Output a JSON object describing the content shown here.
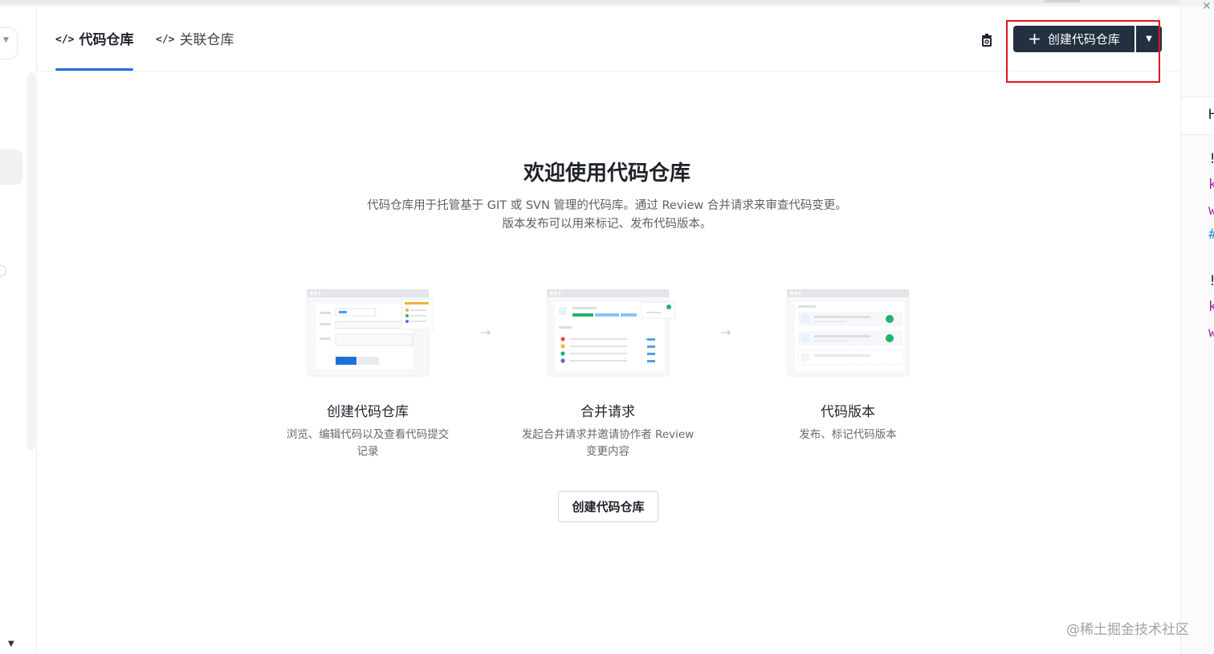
{
  "tabs": [
    {
      "icon": "</>",
      "label": "代码仓库",
      "active": true
    },
    {
      "icon": "</>",
      "label": "关联仓库",
      "active": false
    }
  ],
  "header": {
    "primary_button_label": "创建代码仓库",
    "primary_button_icon": "+",
    "dropdown_icon": "caret-down-icon",
    "trash_icon": "trash-icon"
  },
  "welcome": {
    "title": "欢迎使用代码仓库",
    "description_line1": "代码仓库用于托管基于 GIT 或 SVN 管理的代码库。通过 Review 合并请求来审查代码变更。",
    "description_line2": "版本发布可以用来标记、发布代码版本。"
  },
  "steps": [
    {
      "title": "创建代码仓库",
      "desc_line1": "浏览、编辑代码以及查看代码提交",
      "desc_line2": "记录"
    },
    {
      "title": "合并请求",
      "desc_line1": "发起合并请求并邀请协作者 Review",
      "desc_line2": "变更内容"
    },
    {
      "title": "代码版本",
      "desc_line1": "发布、标记代码版本",
      "desc_line2": ""
    }
  ],
  "create_button_label": "创建代码仓库",
  "watermark": "@稀土掘金技术社区",
  "right_panel_glyphs": [
    "H",
    "!",
    "k",
    "w",
    "#",
    "!",
    "k",
    "w"
  ],
  "colors": {
    "primary_dark": "#23303f",
    "accent_blue": "#1e6fdc",
    "highlight_red": "#e0141d"
  }
}
